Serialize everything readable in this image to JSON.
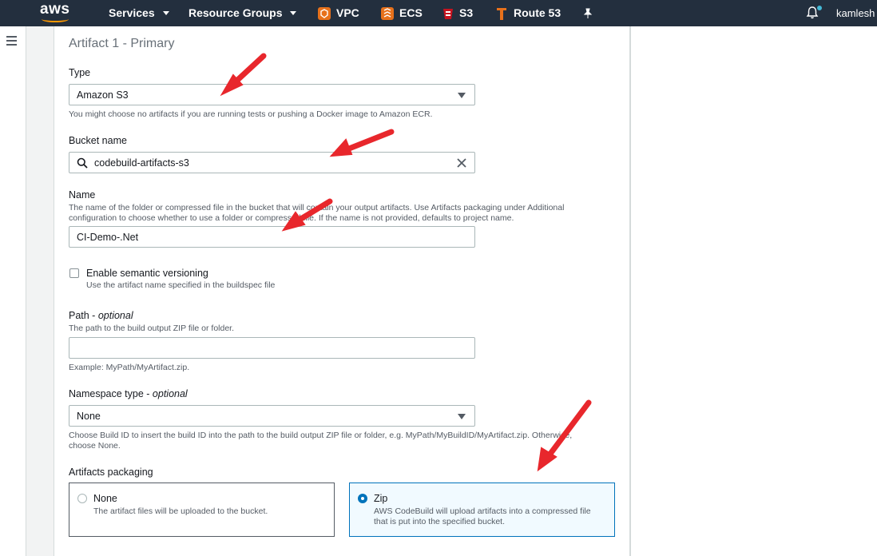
{
  "nav": {
    "services": "Services",
    "resource_groups": "Resource Groups",
    "vpc": "VPC",
    "ecs": "ECS",
    "s3": "S3",
    "route53": "Route 53",
    "user": "kamlesh c",
    "colors": {
      "bar": "#232f3e",
      "accent": "#ff9900"
    }
  },
  "section": {
    "title": "Artifact 1 - Primary"
  },
  "type": {
    "label": "Type",
    "value": "Amazon S3",
    "hint": "You might choose no artifacts if you are running tests or pushing a Docker image to Amazon ECR."
  },
  "bucket": {
    "label": "Bucket name",
    "value": "codebuild-artifacts-s3"
  },
  "name": {
    "label": "Name",
    "desc_line1": "The name of the folder or compressed file in the bucket that will contain your output artifacts. Use Artifacts packaging under Additional",
    "desc_line2": "configuration to choose whether to use a folder or compressed file. If the name is not provided, defaults to project name.",
    "value": "CI-Demo-.Net"
  },
  "semver": {
    "label": "Enable semantic versioning",
    "desc": "Use the artifact name specified in the buildspec file"
  },
  "path": {
    "label": "Path - ",
    "label_optional": "optional",
    "desc": "The path to the build output ZIP file or folder.",
    "value": "",
    "example": "Example: MyPath/MyArtifact.zip."
  },
  "namespace": {
    "label": "Namespace type - ",
    "label_optional": "optional",
    "value": "None",
    "hint_line1": "Choose Build ID to insert the build ID into the path to the build output ZIP file or folder, e.g. MyPath/MyBuildID/MyArtifact.zip. Otherwise,",
    "hint_line2": "choose None."
  },
  "packaging": {
    "label": "Artifacts packaging",
    "none_title": "None",
    "none_desc": "The artifact files will be uploaded to the bucket.",
    "zip_title": "Zip",
    "zip_desc_line1": "AWS CodeBuild will upload artifacts into a compressed file",
    "zip_desc_line2": "that is put into the specified bucket.",
    "selected": "Zip"
  }
}
